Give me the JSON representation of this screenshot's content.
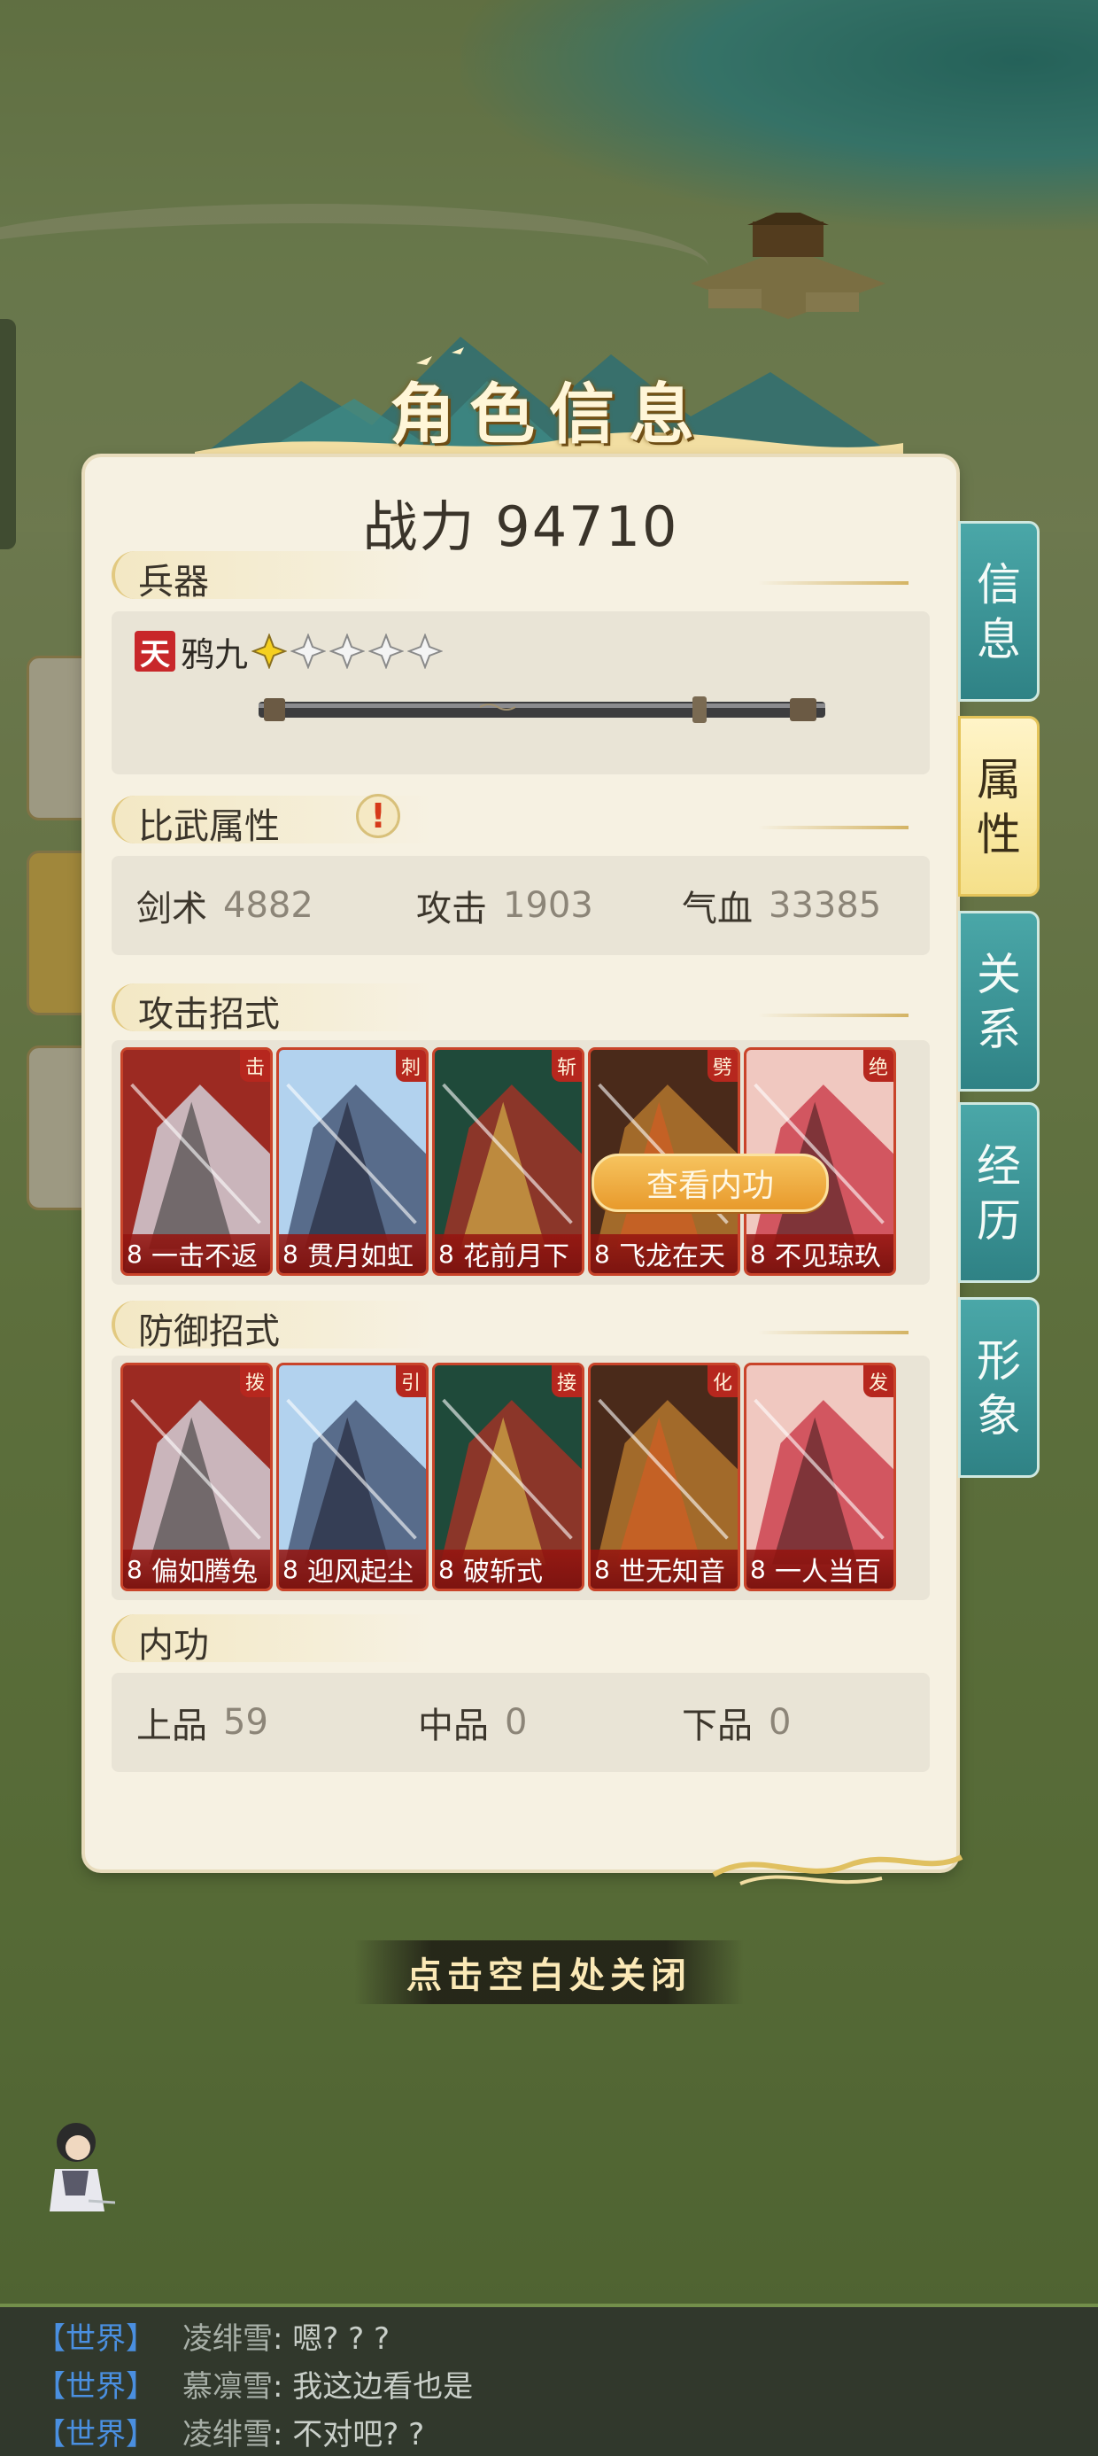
{
  "banner": {
    "title": "角色信息"
  },
  "power": {
    "label": "战力",
    "value": "94710"
  },
  "weapon": {
    "section_title": "兵器",
    "grade": "天",
    "name": "鸦九",
    "stars_filled": 1,
    "stars_total": 5
  },
  "combat_attrs": {
    "section_title": "比武属性",
    "alert": "!",
    "stats": [
      {
        "label": "剑术",
        "value": "4882"
      },
      {
        "label": "攻击",
        "value": "1903"
      },
      {
        "label": "气血",
        "value": "33385"
      }
    ]
  },
  "attack_skills": {
    "section_title": "攻击招式",
    "cards": [
      {
        "type": "击",
        "level": "8",
        "name": "一击不返"
      },
      {
        "type": "刺",
        "level": "8",
        "name": "贯月如虹"
      },
      {
        "type": "斩",
        "level": "8",
        "name": "花前月下"
      },
      {
        "type": "劈",
        "level": "8",
        "name": "飞龙在天"
      },
      {
        "type": "绝",
        "level": "8",
        "name": "不见琼玖"
      }
    ]
  },
  "defense_skills": {
    "section_title": "防御招式",
    "cards": [
      {
        "type": "拨",
        "level": "8",
        "name": "偏如腾兔"
      },
      {
        "type": "引",
        "level": "8",
        "name": "迎风起尘"
      },
      {
        "type": "接",
        "level": "8",
        "name": "破斩式"
      },
      {
        "type": "化",
        "level": "8",
        "name": "世无知音"
      },
      {
        "type": "发",
        "level": "8",
        "name": "一人当百"
      }
    ]
  },
  "neigong": {
    "section_title": "内功",
    "button": "查看内功",
    "stats": [
      {
        "label": "上品",
        "value": "59"
      },
      {
        "label": "中品",
        "value": "0"
      },
      {
        "label": "下品",
        "value": "0"
      }
    ]
  },
  "side_tabs": [
    {
      "label": "信息",
      "active": false
    },
    {
      "label": "属性",
      "active": true
    },
    {
      "label": "关系",
      "active": false
    },
    {
      "label": "经历",
      "active": false
    },
    {
      "label": "形象",
      "active": false
    }
  ],
  "close_hint": "点击空白处关闭",
  "chat": [
    {
      "channel": "【世界】",
      "sender": "凌绯雪",
      "message": ": 嗯? ? ?"
    },
    {
      "channel": "【世界】",
      "sender": "慕凛雪",
      "message": ": 我这边看也是"
    },
    {
      "channel": "【世界】",
      "sender": "凌绯雪",
      "message": ": 不对吧? ?"
    }
  ],
  "colors": {
    "accent_teal": "#3a9698",
    "card_red": "#b6271e",
    "button_gold": "#f0ae44",
    "grade_red": "#c8272a",
    "chat_channel": "#4a8fe0"
  }
}
